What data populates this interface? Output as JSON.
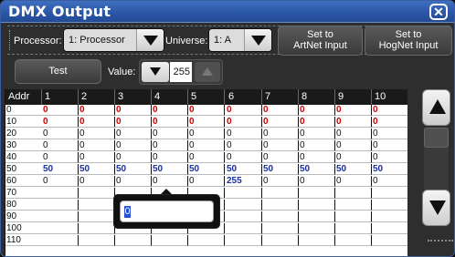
{
  "window": {
    "title": "DMX Output"
  },
  "toolbar": {
    "processor_label": "Processor:",
    "processor_value": "1: Processor",
    "universe_label": "Universe:",
    "universe_value": "1: A",
    "artnet_label_line1": "Set to",
    "artnet_label_line2": "ArtNet Input",
    "hognet_label_line1": "Set to",
    "hognet_label_line2": "HogNet Input",
    "test_label": "Test",
    "value_label": "Value:",
    "value": "255"
  },
  "grid": {
    "addr_header": "Addr",
    "columns": [
      "1",
      "2",
      "3",
      "4",
      "5",
      "6",
      "7",
      "8",
      "9",
      "10"
    ],
    "rows": [
      {
        "addr": "0",
        "style": "red",
        "cells": [
          "0",
          "0",
          "0",
          "0",
          "0",
          "0",
          "0",
          "0",
          "0",
          "0"
        ]
      },
      {
        "addr": "10",
        "style": "red",
        "cells": [
          "0",
          "0",
          "0",
          "0",
          "0",
          "0",
          "0",
          "0",
          "0",
          "0"
        ]
      },
      {
        "addr": "20",
        "style": "",
        "cells": [
          "0",
          "0",
          "0",
          "0",
          "0",
          "0",
          "0",
          "0",
          "0",
          "0"
        ]
      },
      {
        "addr": "30",
        "style": "",
        "cells": [
          "0",
          "0",
          "0",
          "0",
          "0",
          "0",
          "0",
          "0",
          "0",
          "0"
        ]
      },
      {
        "addr": "40",
        "style": "",
        "cells": [
          "0",
          "0",
          "0",
          "0",
          "0",
          "0",
          "0",
          "0",
          "0",
          "0"
        ]
      },
      {
        "addr": "50",
        "style": "blue",
        "cells": [
          "50",
          "50",
          "50",
          "50",
          "50",
          "50",
          "50",
          "50",
          "50",
          "50"
        ]
      },
      {
        "addr": "60",
        "style": "",
        "cells": [
          "0",
          "0",
          "0",
          "0",
          "0",
          "255",
          "0",
          "0",
          "0",
          "0"
        ]
      },
      {
        "addr": "70",
        "style": "",
        "cells": [
          "",
          "",
          "",
          "",
          "",
          "",
          "",
          "",
          "",
          ""
        ]
      },
      {
        "addr": "80",
        "style": "",
        "cells": [
          "",
          "",
          "",
          "",
          "",
          "",
          "",
          "",
          "",
          ""
        ]
      },
      {
        "addr": "90",
        "style": "",
        "cells": [
          "",
          "",
          "",
          "",
          "",
          "",
          "",
          "",
          "",
          ""
        ]
      },
      {
        "addr": "100",
        "style": "",
        "cells": [
          "",
          "",
          "",
          "",
          "",
          "",
          "",
          "",
          "",
          ""
        ]
      },
      {
        "addr": "110",
        "style": "",
        "cells": [
          "",
          "",
          "",
          "",
          "",
          "",
          "",
          "",
          "",
          ""
        ]
      }
    ]
  },
  "editor": {
    "value": "0"
  },
  "colors": {
    "titlebar": "#2a55a5",
    "red_value": "#cc0000",
    "blue_value": "#1a2fa0"
  }
}
